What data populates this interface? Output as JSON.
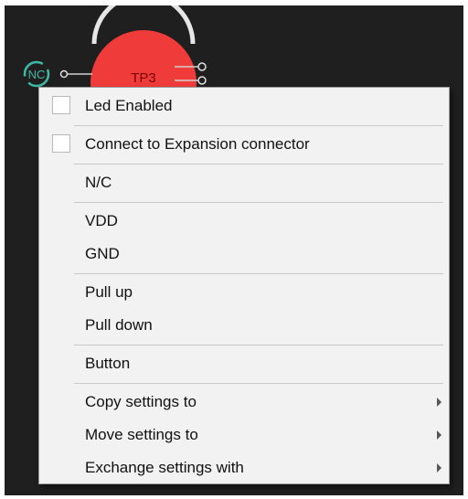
{
  "schematic": {
    "nc_label": "NC",
    "testpoint_label": "TP3",
    "colors": {
      "background": "#1f1f1f",
      "testpoint_fill": "#f03b3b",
      "testpoint_text": "#7a0000",
      "nc_ring": "#3fb8a6",
      "wire": "#cfcfcf"
    }
  },
  "menu": {
    "items": [
      {
        "label": "Led Enabled",
        "checkbox": true,
        "checked": false
      },
      {
        "label": "Connect to Expansion connector",
        "checkbox": true,
        "checked": false
      },
      {
        "label": "N/C"
      },
      {
        "label": "VDD"
      },
      {
        "label": "GND"
      },
      {
        "label": "Pull up"
      },
      {
        "label": "Pull down"
      },
      {
        "label": "Button"
      },
      {
        "label": "Copy settings to",
        "submenu": true
      },
      {
        "label": "Move settings to",
        "submenu": true
      },
      {
        "label": "Exchange settings with",
        "submenu": true
      }
    ]
  }
}
